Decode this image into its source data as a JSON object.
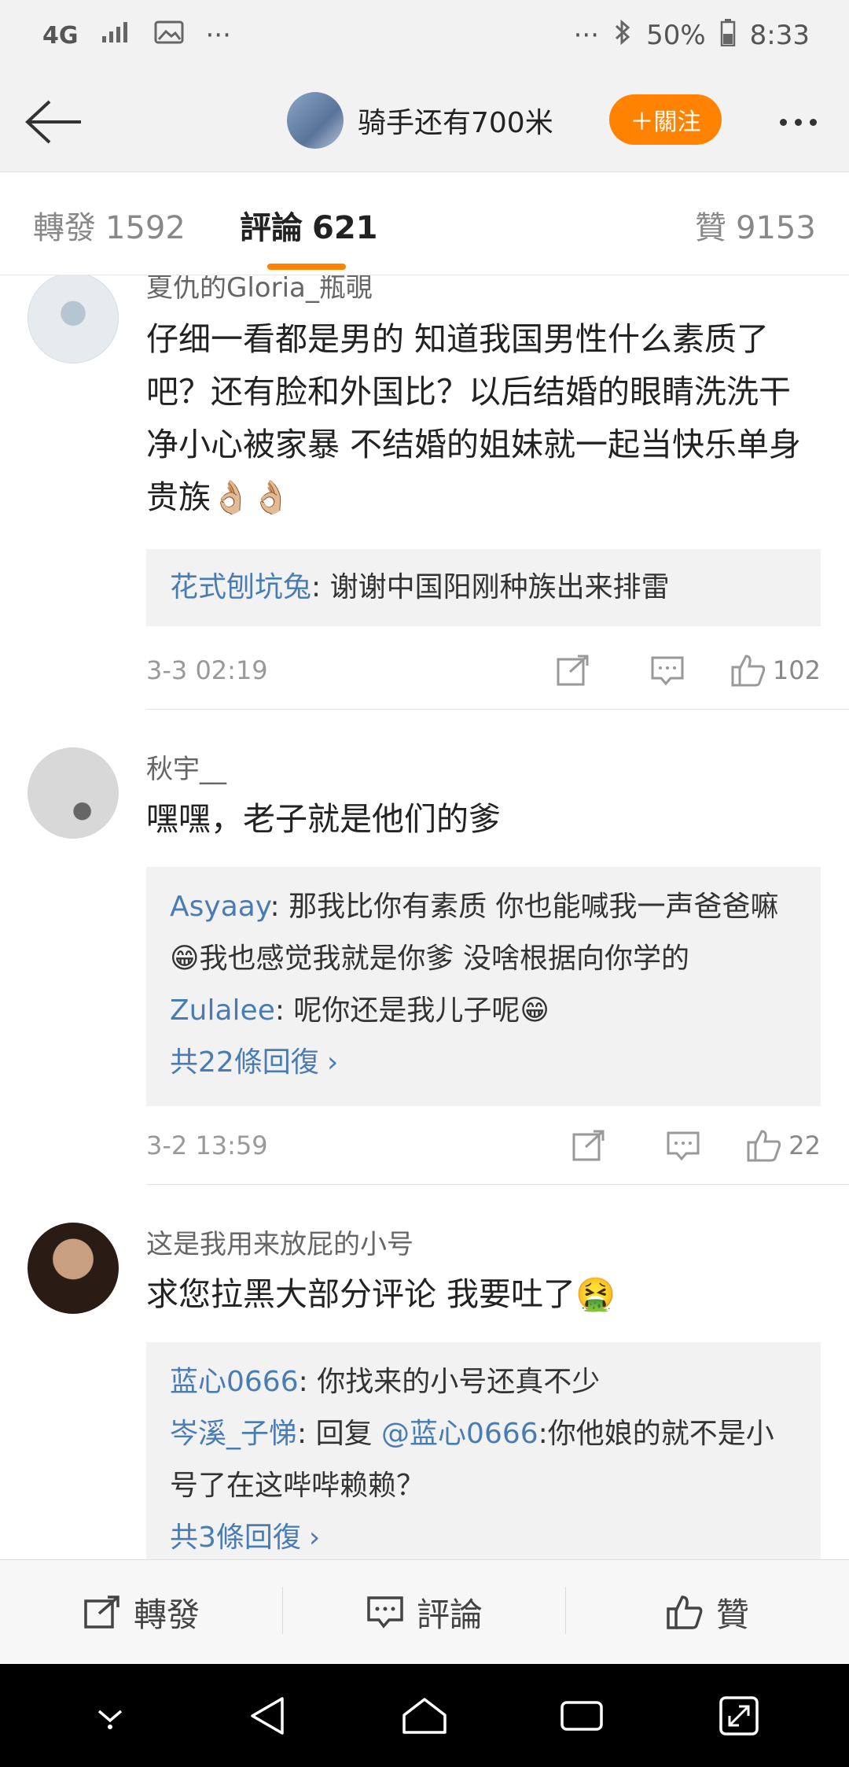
{
  "status_bar": {
    "network": "4G",
    "battery": "50%",
    "time": "8:33",
    "left_dots": "···",
    "right_dots": "···"
  },
  "header": {
    "author_name": "骑手还有700米",
    "follow_label": "＋關注"
  },
  "tabs": [
    {
      "label": "轉發",
      "count": "1592"
    },
    {
      "label": "評論",
      "count": "621"
    },
    {
      "label": "贊",
      "count": "9153"
    }
  ],
  "comments": [
    {
      "user": "夏仇的Gloria_瓶覗",
      "text": "仔细一看都是男的 知道我国男性什么素质了吧？还有脸和外国比？以后结婚的眼睛洗洗干净小心被家暴 不结婚的姐妹就一起当快乐单身贵族👌🏼👌🏼",
      "replies": [
        {
          "user": "花式刨坑兔",
          "text": ": 谢谢中国阳刚种族出来排雷"
        }
      ],
      "time": "3-3 02:19",
      "likes": "102"
    },
    {
      "user": "秋宇__",
      "text": "嘿嘿，老子就是他们的爹",
      "replies": [
        {
          "user": "Asyaay",
          "text": ": 那我比你有素质 你也能喊我一声爸爸嘛😁我也感觉我就是你爹 没啥根据向你学的"
        },
        {
          "user": "Zulalee",
          "text": ": 呢你还是我儿子呢😁"
        }
      ],
      "more": "共22條回復",
      "time": "3-2 13:59",
      "likes": "22"
    },
    {
      "user": "这是我用来放屁的小号",
      "text": "求您拉黑大部分评论 我要吐了🤮",
      "replies": [
        {
          "user": "蓝心0666",
          "text": ": 你找来的小号还真不少"
        },
        {
          "user": "岑溪_子悌",
          "text": ": 回复 ",
          "mention": "@蓝心0666",
          "after": ":你他娘的就不是小号了在这哔哔赖赖？"
        }
      ],
      "more": "共3條回復"
    }
  ],
  "actionbar": {
    "repost": "轉發",
    "comment": "評論",
    "like": "贊"
  },
  "icons": {
    "back": "back-arrow-icon",
    "more": "more-dots-icon",
    "share": "share-icon",
    "comment": "comment-icon",
    "like": "thumb-up-icon"
  },
  "colors": {
    "accent": "#ff8200",
    "link": "#4a7cb4"
  }
}
